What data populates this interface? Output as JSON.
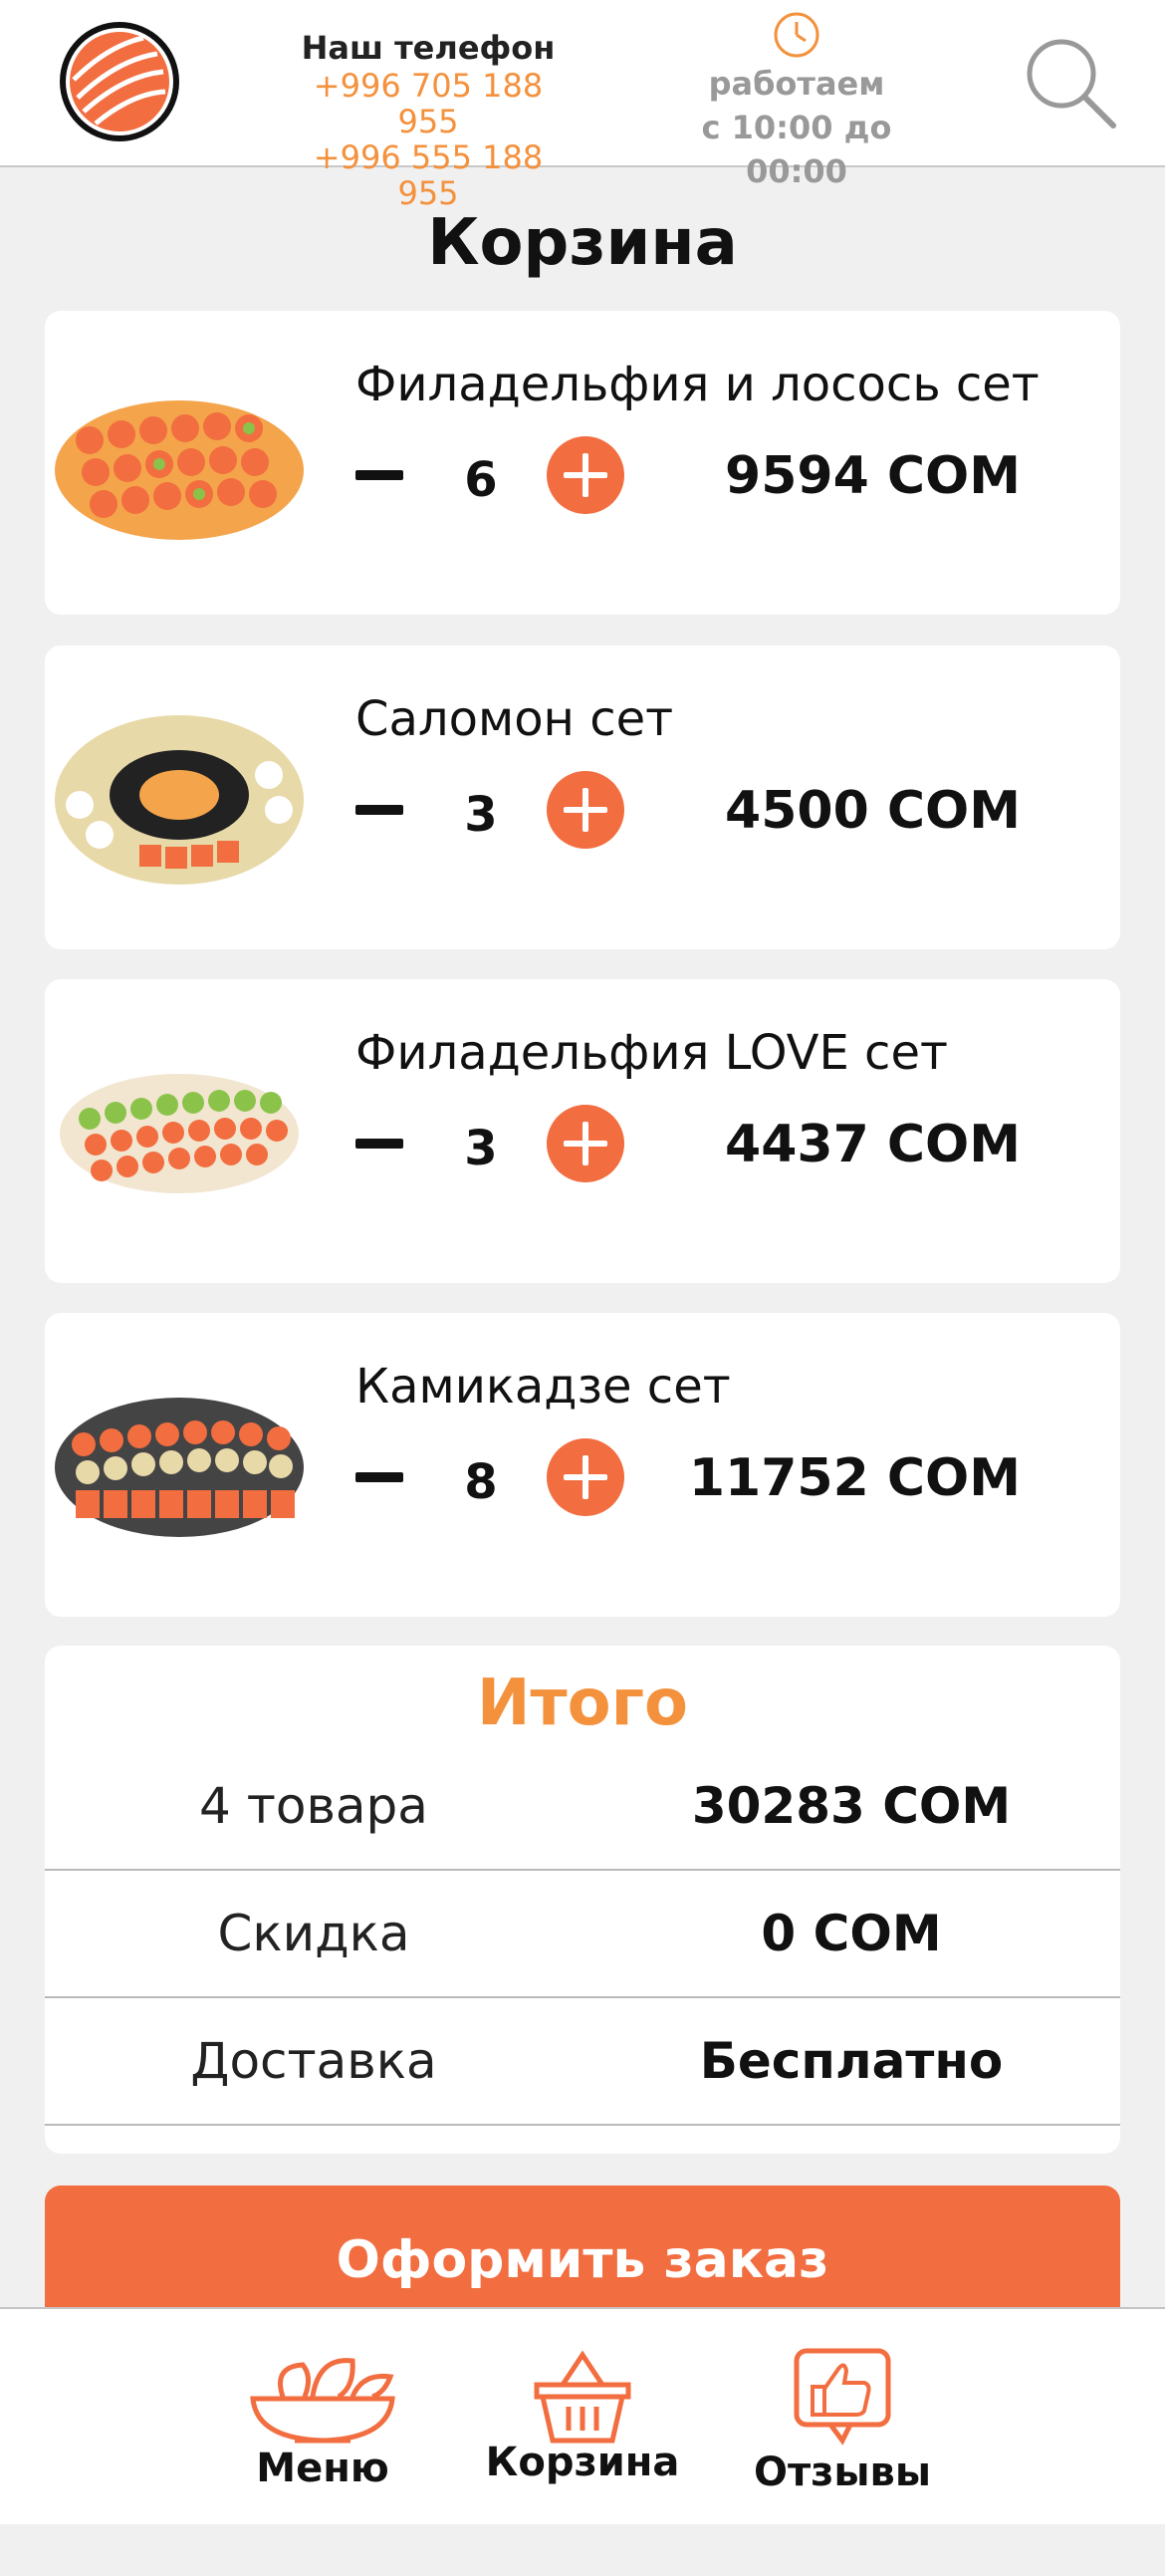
{
  "header": {
    "phone_title": "Наш телефон",
    "phones": [
      "+996 705 188 955",
      "+996 555 188 955"
    ],
    "hours_label": "работаем",
    "hours_text": "с 10:00 до 00:00"
  },
  "page_title": "Корзина",
  "cart": {
    "items": [
      {
        "name": "Филадельфия и лосось сет",
        "qty": "6",
        "price": "9594 СОМ",
        "image": "sushi-set-image"
      },
      {
        "name": "Саломон сет",
        "qty": "3",
        "price": "4500 СОМ",
        "image": "sushi-set-image"
      },
      {
        "name": "Филадельфия LOVE сет",
        "qty": "3",
        "price": "4437 СОМ",
        "image": "sushi-set-image"
      },
      {
        "name": "Камикадзе сет",
        "qty": "8",
        "price": "11752 СОМ",
        "image": "sushi-set-image"
      }
    ]
  },
  "summary": {
    "title": "Итого",
    "rows": [
      {
        "label": "4 товара",
        "value": "30283 СОМ"
      },
      {
        "label": "Скидка",
        "value": "0 СОМ"
      },
      {
        "label": "Доставка",
        "value": "Бесплатно"
      }
    ]
  },
  "checkout_label": "Оформить заказ",
  "nav": {
    "items": [
      {
        "label": "Меню",
        "icon": "salad-bowl-icon"
      },
      {
        "label": "Корзина",
        "icon": "basket-icon"
      },
      {
        "label": "Отзывы",
        "icon": "thumbs-up-icon"
      }
    ]
  },
  "colors": {
    "accent": "#f26d3f",
    "accent_text": "#f4913d",
    "muted_text": "#999999",
    "background": "#f0f0f0"
  }
}
